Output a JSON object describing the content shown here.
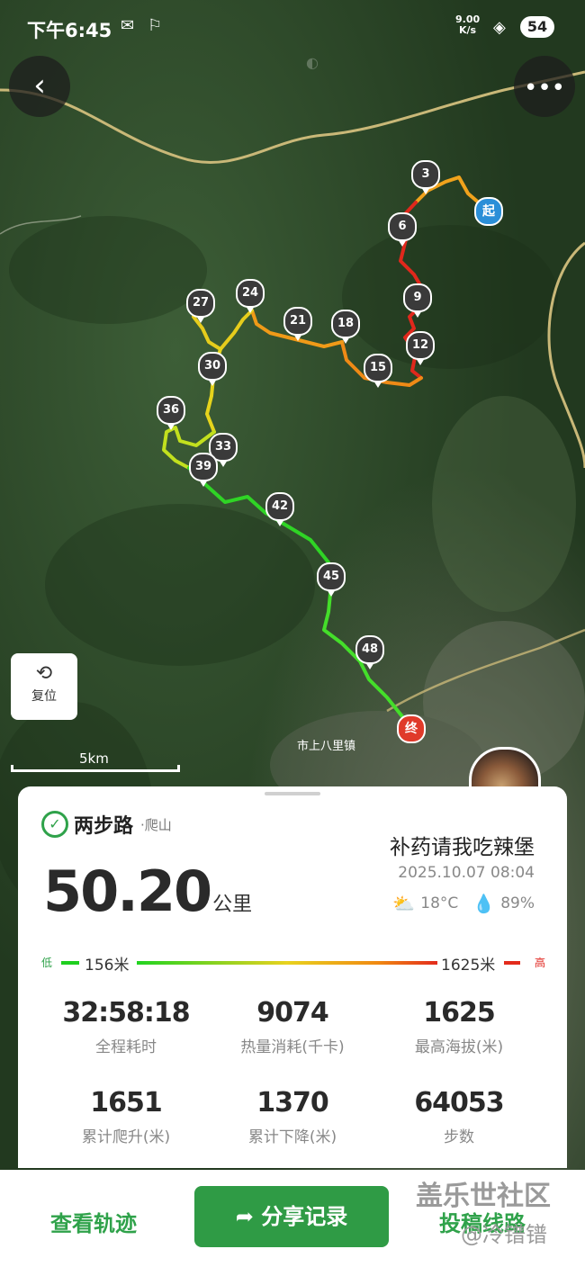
{
  "status_bar": {
    "time": "下午6:45",
    "net_speed_top": "9.00",
    "net_speed_bottom": "K/s",
    "battery": "54"
  },
  "map": {
    "place_label": "市上八里镇",
    "scale_label": "5km",
    "reset_label": "复位",
    "markers": [
      {
        "label": "起",
        "type": "start"
      },
      {
        "label": "3"
      },
      {
        "label": "6"
      },
      {
        "label": "9"
      },
      {
        "label": "12"
      },
      {
        "label": "15"
      },
      {
        "label": "18"
      },
      {
        "label": "21"
      },
      {
        "label": "24"
      },
      {
        "label": "27"
      },
      {
        "label": "30"
      },
      {
        "label": "33"
      },
      {
        "label": "36"
      },
      {
        "label": "39"
      },
      {
        "label": "42"
      },
      {
        "label": "45"
      },
      {
        "label": "48"
      },
      {
        "label": "终",
        "type": "end"
      }
    ]
  },
  "card": {
    "brand_name": "两步路",
    "sport": "·爬山",
    "username": "补药请我吃辣堡",
    "distance": "50.20",
    "distance_unit": "公里",
    "datetime": "2025.10.07 08:04",
    "temperature": "18°C",
    "humidity": "89%",
    "elevation": {
      "low_label": "低",
      "high_label": "高",
      "min": "156米",
      "max": "1625米"
    },
    "stats": [
      {
        "value": "32:58:18",
        "label": "全程耗时"
      },
      {
        "value": "9074",
        "label": "热量消耗(千卡)"
      },
      {
        "value": "1625",
        "label": "最高海拔(米)"
      },
      {
        "value": "1651",
        "label": "累计爬升(米)"
      },
      {
        "value": "1370",
        "label": "累计下降(米)"
      },
      {
        "value": "64053",
        "label": "步数"
      }
    ]
  },
  "bottom_bar": {
    "view_track": "查看轨迹",
    "share_record": "分享记录",
    "submit_route": "投稿线路"
  },
  "watermark": {
    "line1": "盖乐世社区",
    "line2": "@冷镨镨"
  }
}
